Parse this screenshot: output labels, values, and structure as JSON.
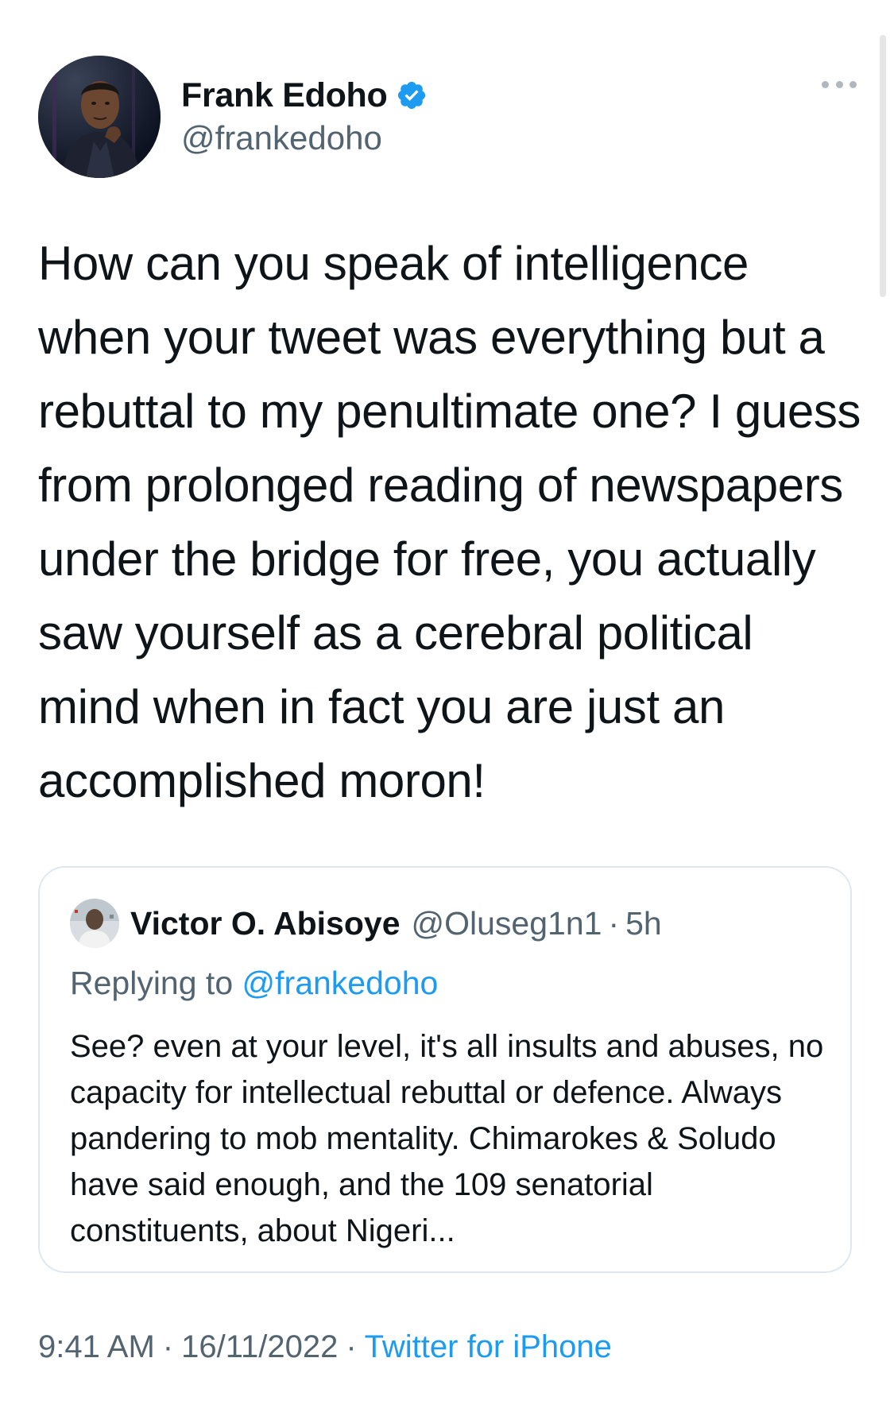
{
  "author": {
    "display_name": "Frank Edoho",
    "handle": "@frankedoho",
    "verified": true,
    "avatar_icon": "profile-photo",
    "verified_icon": "verified-badge-icon"
  },
  "more_icon": "more-horizontal-icon",
  "tweet": {
    "text": "How can you speak of intelligence when your tweet was everything but a rebuttal to my penultimate one? I guess from prolonged reading of newspapers under the bridge for free, you actually saw yourself as a cerebral political mind when in fact you are just an accomplished moron!"
  },
  "quoted_tweet": {
    "display_name": "Victor O. Abisoye",
    "handle": "@Oluseg1n1",
    "separator": "·",
    "time": "5h",
    "replying_label": "Replying to",
    "replying_to": "@frankedoho",
    "text": "See? even at your level, it's all insults and abuses, no capacity for intellectual rebuttal or defence. Always pandering to mob mentality. Chimarokes & Soludo have said enough, and the 109 senatorial constituents, about Nigeri..."
  },
  "meta": {
    "time": "9:41 AM",
    "separator": "·",
    "date": "16/11/2022",
    "source": "Twitter for iPhone"
  },
  "colors": {
    "text": "#0f1419",
    "secondary": "#536471",
    "accent": "#1d9bf0",
    "border": "#e1e8ed"
  }
}
